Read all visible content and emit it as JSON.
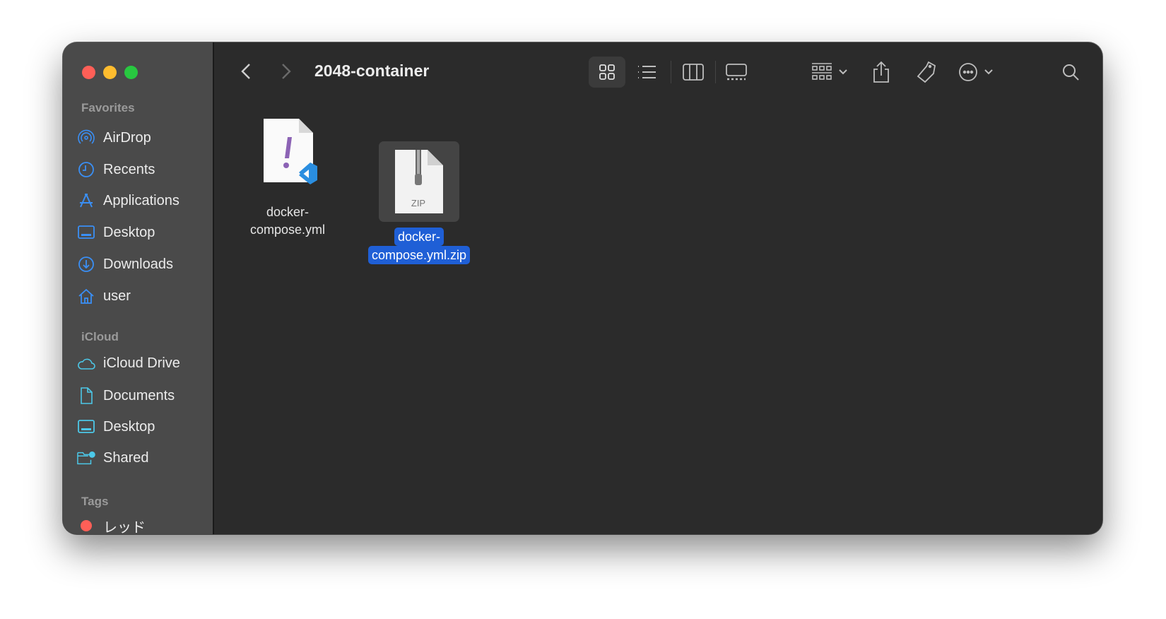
{
  "window": {
    "title": "2048-container"
  },
  "sidebar": {
    "favorites_header": "Favorites",
    "favorites": [
      {
        "label": "AirDrop",
        "icon": "airdrop-icon"
      },
      {
        "label": "Recents",
        "icon": "clock-icon"
      },
      {
        "label": "Applications",
        "icon": "applications-icon"
      },
      {
        "label": "Desktop",
        "icon": "desktop-icon"
      },
      {
        "label": "Downloads",
        "icon": "download-icon"
      },
      {
        "label": "user",
        "icon": "home-icon"
      }
    ],
    "icloud_header": "iCloud",
    "icloud": [
      {
        "label": "iCloud Drive",
        "icon": "cloud-icon"
      },
      {
        "label": "Documents",
        "icon": "document-icon"
      },
      {
        "label": "Desktop",
        "icon": "desktop-icon"
      },
      {
        "label": "Shared",
        "icon": "shared-folder-icon"
      }
    ],
    "tags_header": "Tags",
    "tags": [
      {
        "label": "レッド",
        "color": "#ff5f57"
      }
    ]
  },
  "files": [
    {
      "line1": "docker-",
      "line2": "compose.yml",
      "selected": false
    },
    {
      "line1": "docker-",
      "line2": "compose.yml.zip",
      "badge": "ZIP",
      "selected": true
    }
  ],
  "colors": {
    "accent": "#1f5fd6",
    "sidebar_icon": "#3a8ff5",
    "icloud_icon": "#4cc8e8"
  }
}
